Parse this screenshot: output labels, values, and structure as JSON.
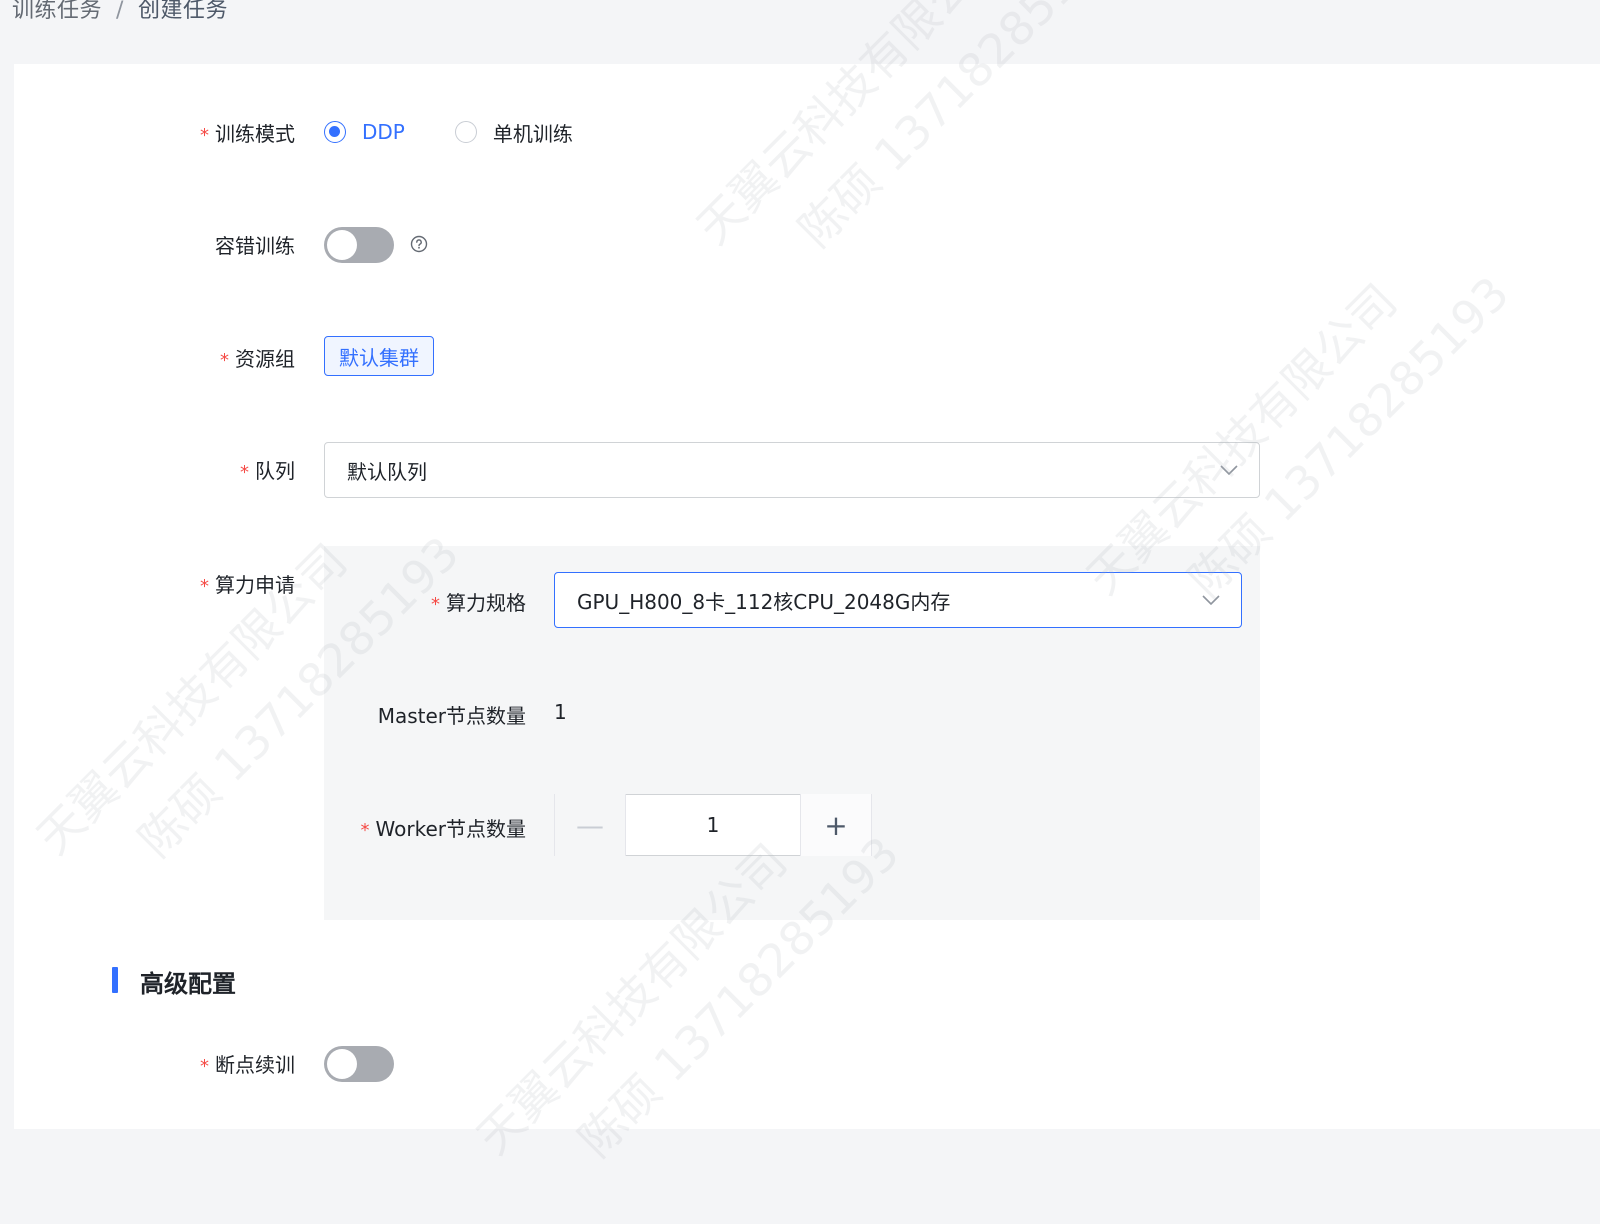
{
  "breadcrumb": {
    "parent": "训练任务",
    "separator": "/",
    "current": "创建任务"
  },
  "form": {
    "training_mode": {
      "label": "训练模式",
      "required": true,
      "options": [
        "DDP",
        "单机训练"
      ],
      "selected": "DDP"
    },
    "fault_tolerance": {
      "label": "容错训练",
      "enabled": false,
      "help_icon": "question-circle-icon"
    },
    "resource_group": {
      "label": "资源组",
      "required": true,
      "value": "默认集群"
    },
    "queue": {
      "label": "队列",
      "required": true,
      "value": "默认队列"
    },
    "compute": {
      "label": "算力申请",
      "required": true,
      "spec_label": "算力规格",
      "spec_value": "GPU_H800_8卡_112核CPU_2048G内存",
      "master_label": "Master节点数量",
      "master_value": "1",
      "worker_label": "Worker节点数量",
      "worker_value": "1",
      "minus_symbol": "—",
      "plus_symbol": "+"
    },
    "advanced": {
      "title": "高级配置",
      "checkpoint_resume": {
        "label": "断点续训",
        "required": true,
        "enabled": false
      }
    }
  },
  "watermark": {
    "line1": "天翼云科技有限公司",
    "line2": "陈硕 13718285193"
  },
  "colors": {
    "accent": "#3370ff",
    "required": "#f54a45",
    "switch_off": "#a8abb1"
  }
}
